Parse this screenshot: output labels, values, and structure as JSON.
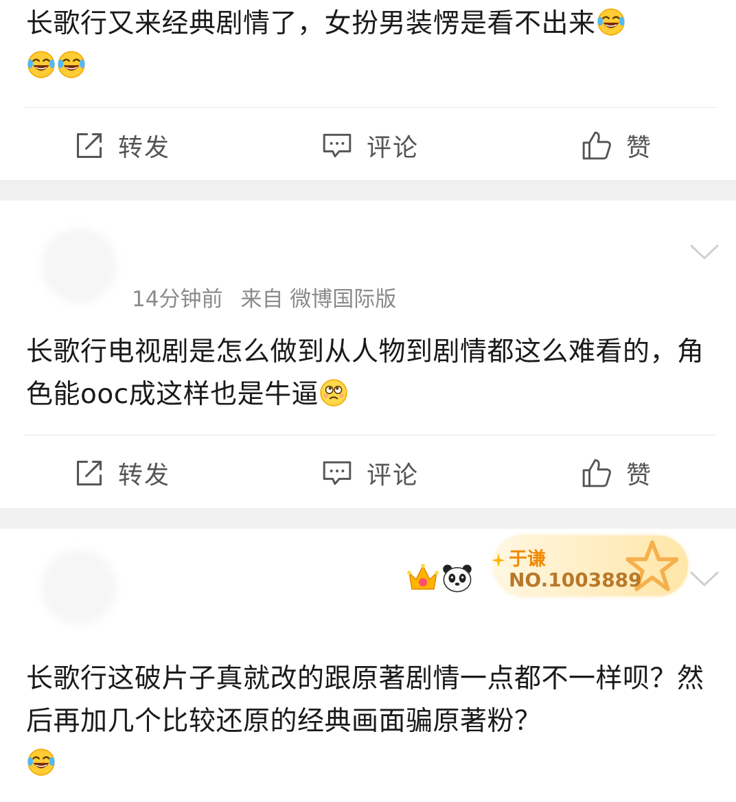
{
  "posts": [
    {
      "text": "长歌行又来经典剧情了，女扮男装愣是看不出来",
      "emojis": [
        "laugh-cry-emoji",
        "laugh-cry-emoji",
        "laugh-cry-emoji"
      ]
    },
    {
      "time": "14分钟前",
      "source": "来自 微博国际版",
      "text": "长歌行电视剧是怎么做到从人物到剧情都这么难看的，角色能ooc成这样也是牛逼",
      "emojis": [
        "cheeky-face-emoji"
      ]
    },
    {
      "badge_name": "于谦",
      "badge_number": "NO.1003889",
      "text": "长歌行这破片子真就改的跟原著剧情一点都不一样呗？然后再加几个比较还原的经典画面骗原著粉？",
      "emojis": [
        "laugh-cry-emoji"
      ]
    }
  ],
  "actions": {
    "repost": "转发",
    "comment": "评论",
    "like": "赞"
  },
  "colors": {
    "text": "#1a1a1a",
    "meta": "#8a8a8a",
    "separator": "#f0f0f0",
    "badge": "#f08a00"
  }
}
